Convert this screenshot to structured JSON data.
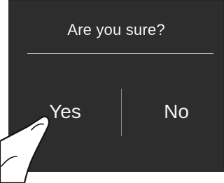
{
  "dialog": {
    "title": "Are you sure?",
    "yes_label": "Yes",
    "no_label": "No"
  },
  "colors": {
    "dialog_background": "#2d2d2d",
    "text": "#f2f2f2",
    "divider": "#bdbdbd",
    "page_background": "#ffffff"
  },
  "icons": {
    "pointer": "finger-tap-icon"
  }
}
